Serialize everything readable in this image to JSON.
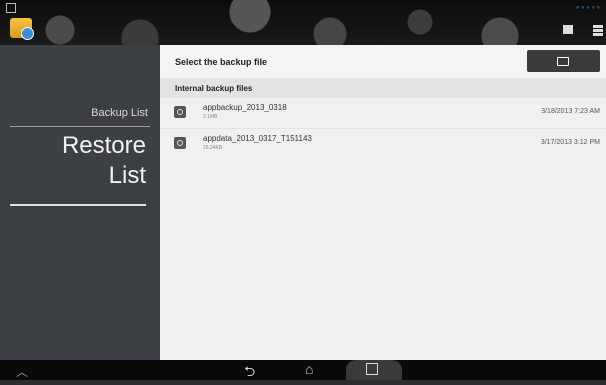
{
  "sidebar": {
    "backup_list": "Backup List",
    "restore_list_line1": "Restore",
    "restore_list_line2": "List"
  },
  "main": {
    "title": "Select the backup file",
    "section": "Internal backup files",
    "files": [
      {
        "name": "appbackup_2013_0318",
        "size": "3.1MB",
        "date": "3/18/2013 7:23 AM"
      },
      {
        "name": "appdata_2013_0317_T151143",
        "size": "26.24KB",
        "date": "3/17/2013 3:12 PM"
      }
    ]
  },
  "icons": {
    "app": "backup-app-icon",
    "folder": "folder-icon",
    "file": "backup-file-icon",
    "back": "back-icon",
    "home": "home-icon",
    "recent": "recent-apps-icon",
    "hide": "hide-keyboard-icon"
  }
}
